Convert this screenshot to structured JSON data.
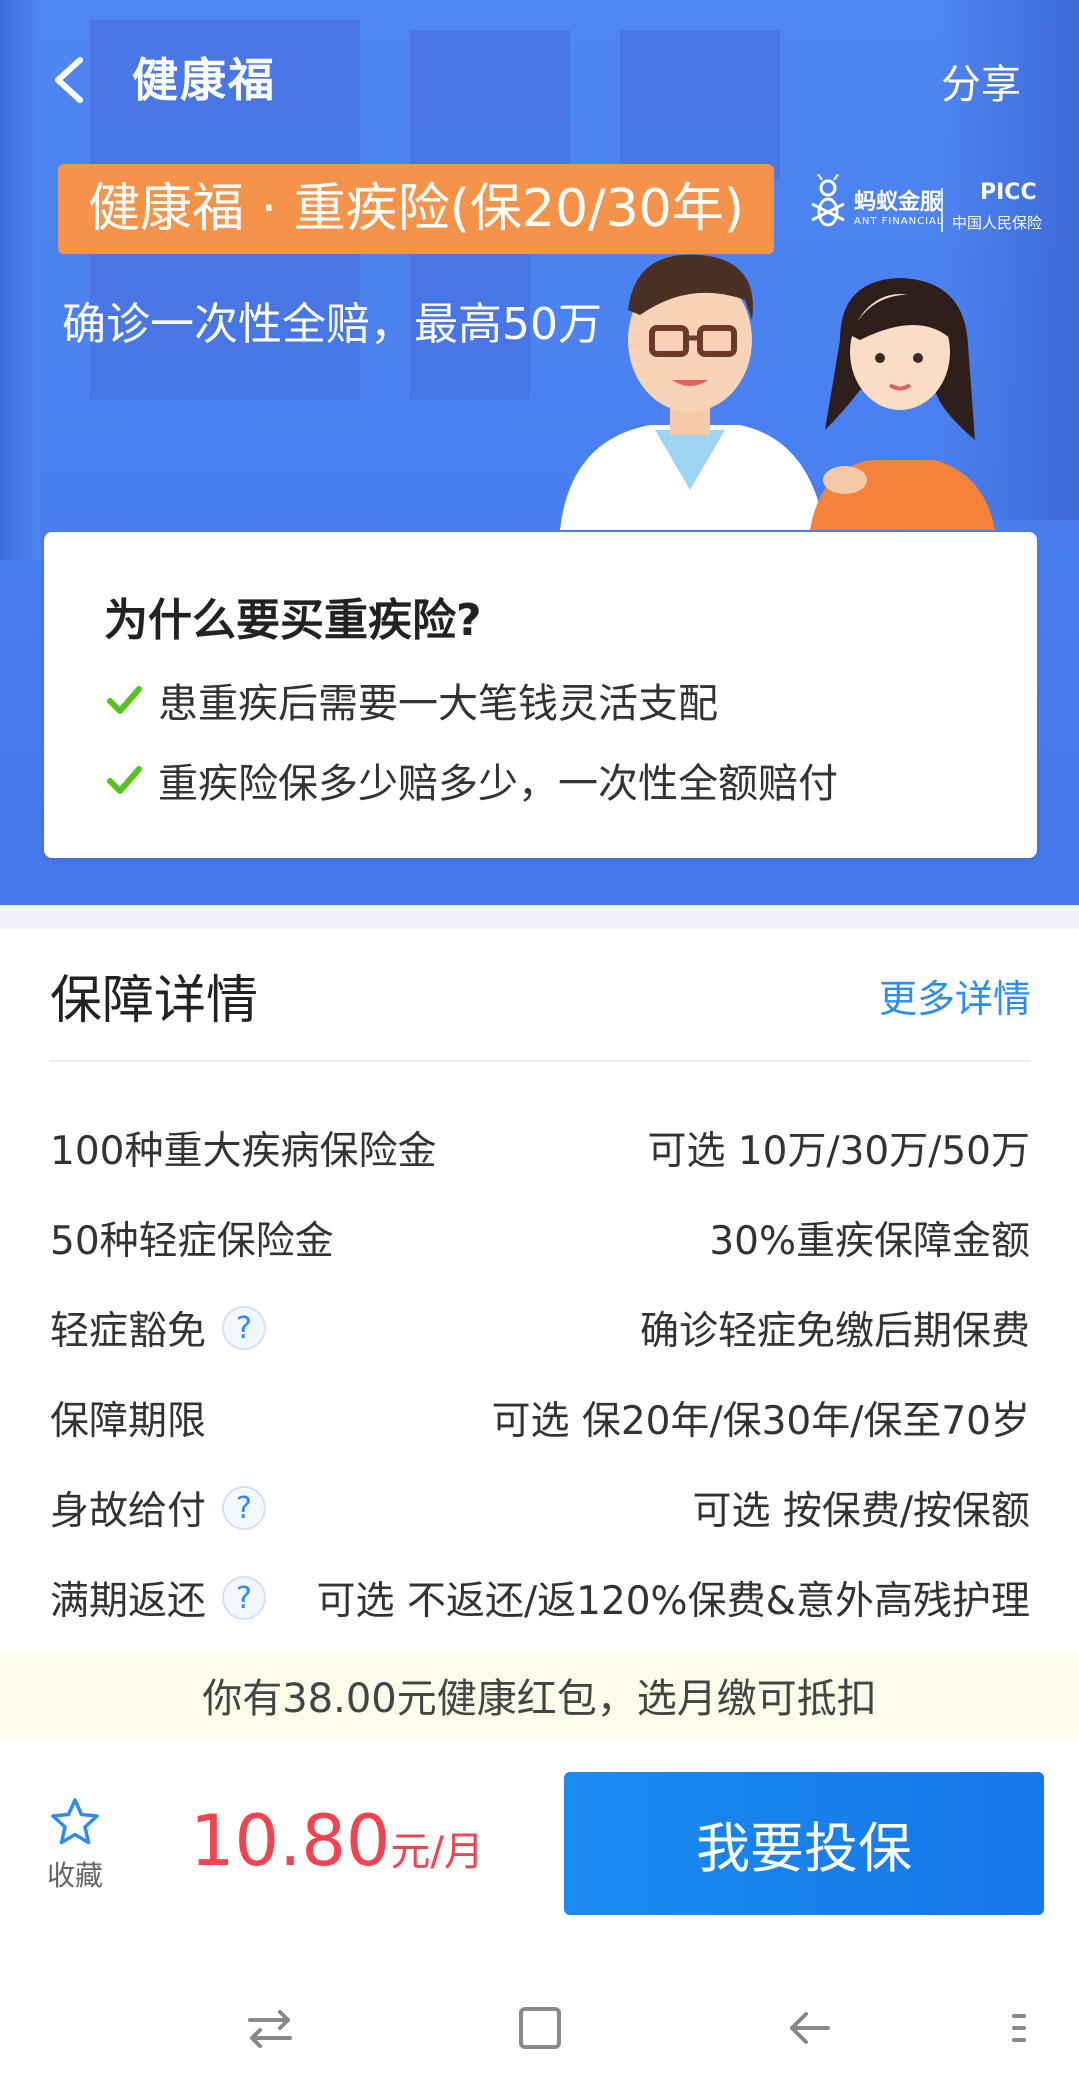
{
  "header": {
    "title": "健康福",
    "share_label": "分享"
  },
  "hero": {
    "tag": "健康福 · 重疾险(保20/30年)",
    "subtitle": "确诊一次性全赔，最高50万",
    "brand_ant": "蚂蚁金服",
    "brand_ant_en": "ANT FINANCIAL",
    "brand_picc": "PICC",
    "brand_picc_cn": "中国人民保险"
  },
  "why": {
    "title": "为什么要买重疾险?",
    "items": [
      "患重疾后需要一大笔钱灵活支配",
      "重疾险保多少赔多少，一次性全额赔付"
    ]
  },
  "details": {
    "title": "保障详情",
    "more_label": "更多详情",
    "help_glyph": "?",
    "rows": [
      {
        "label": "100种重大疾病保险金",
        "value": "可选 10万/30万/50万"
      },
      {
        "label": "50种轻症保险金",
        "value": "30%重疾保障金额"
      },
      {
        "label": "轻症豁免",
        "value": "确诊轻症免缴后期保费"
      },
      {
        "label": "保障期限",
        "value": "可选 保20年/保30年/保至70岁"
      },
      {
        "label": "身故给付",
        "value": "可选 按保费/按保额"
      },
      {
        "label": "满期返还",
        "value": "可选 不返还/返120%保费&意外高残护理"
      }
    ]
  },
  "banner": {
    "text": "你有38.00元健康红包，选月缴可抵扣"
  },
  "bottom": {
    "favorite_label": "收藏",
    "price": "10.80",
    "price_unit": "元/月",
    "buy_label": "我要投保"
  },
  "colors": {
    "hero_blue": "#4a7fef",
    "tag_orange": "#f5934b",
    "link_blue": "#2d8cf0",
    "price_red": "#f2434f",
    "button_blue": "#1a8bf0",
    "check_green": "#52c41a"
  },
  "icons": {
    "back": "chevron-left-icon",
    "check": "check-icon",
    "help": "question-icon",
    "favorite": "star-icon",
    "nav": [
      "swap-icon",
      "home-square-icon",
      "back-arrow-icon",
      "menu-icon"
    ]
  }
}
